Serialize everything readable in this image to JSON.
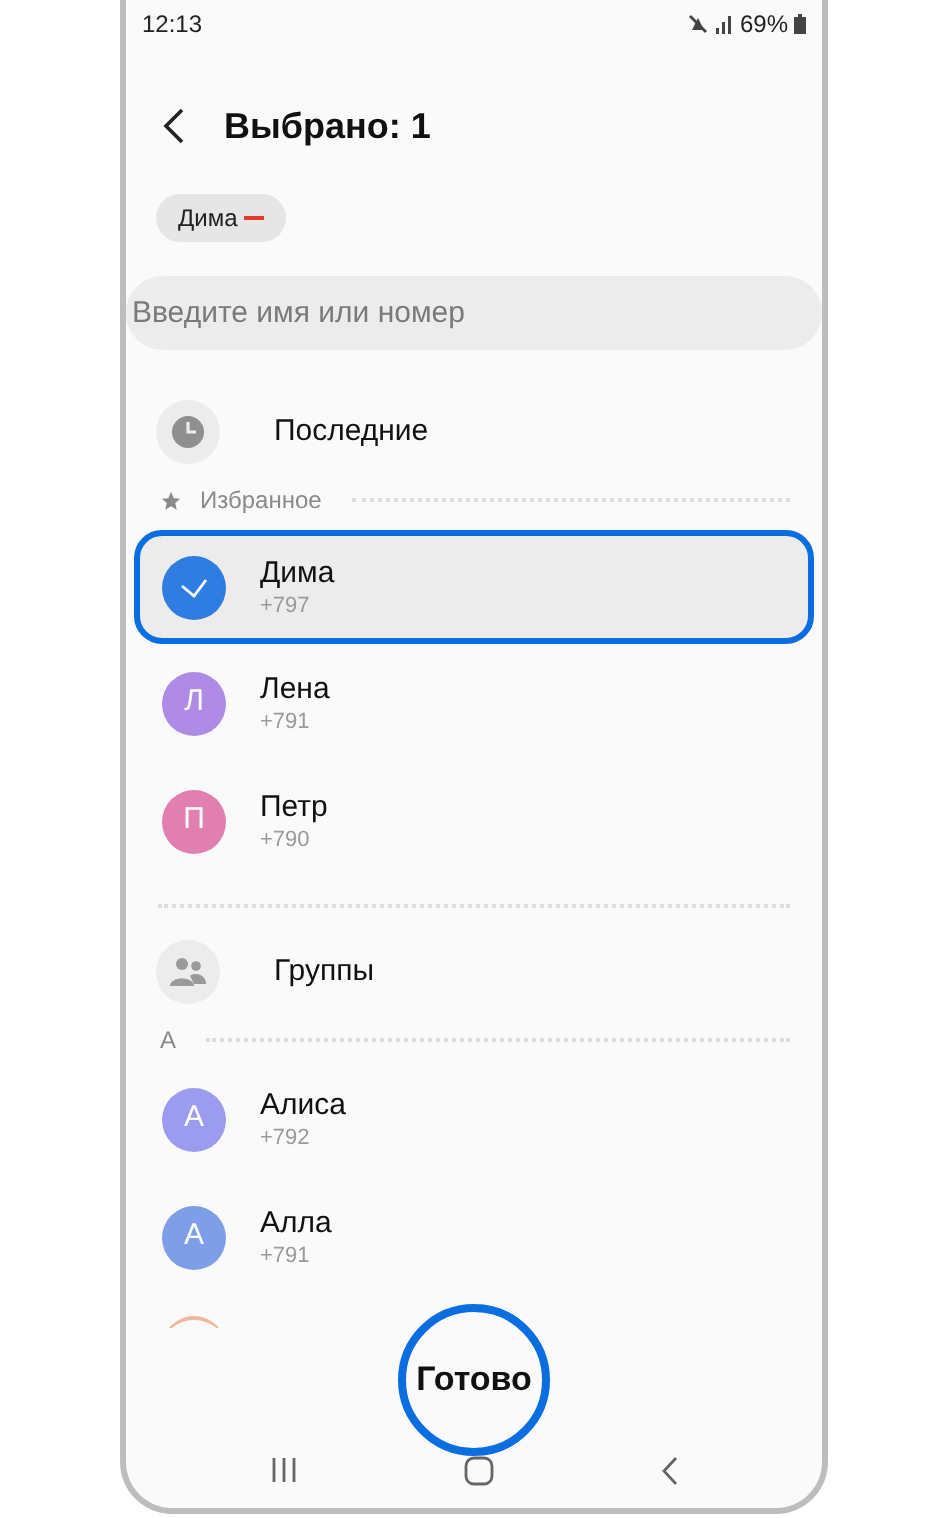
{
  "status_bar": {
    "time": "12:13",
    "battery": "69%"
  },
  "header": {
    "title": "Выбрано: 1"
  },
  "selected_chips": [
    {
      "label": "Дима"
    }
  ],
  "search": {
    "placeholder": "Введите имя или номер"
  },
  "recent": {
    "label": "Последние"
  },
  "favorites": {
    "label": "Избранное",
    "contacts": [
      {
        "name": "Дима",
        "phone": "+797",
        "color": "#2f7de1",
        "selected": true
      },
      {
        "name": "Лена",
        "phone": "+791",
        "initial": "Л",
        "color": "#b08be6",
        "selected": false
      },
      {
        "name": "Петр",
        "phone": "+790",
        "initial": "П",
        "color": "#e07fb0",
        "selected": false
      }
    ]
  },
  "groups": {
    "label": "Группы"
  },
  "sections": [
    {
      "letter": "A",
      "contacts": [
        {
          "name": "Алиса",
          "phone": "+792",
          "initial": "А",
          "color": "#9b9cf0",
          "selected": false
        },
        {
          "name": "Алла",
          "phone": "+791",
          "initial": "А",
          "color": "#7f9ee8",
          "selected": false
        }
      ]
    }
  ],
  "done_button": {
    "label": "Готово"
  }
}
